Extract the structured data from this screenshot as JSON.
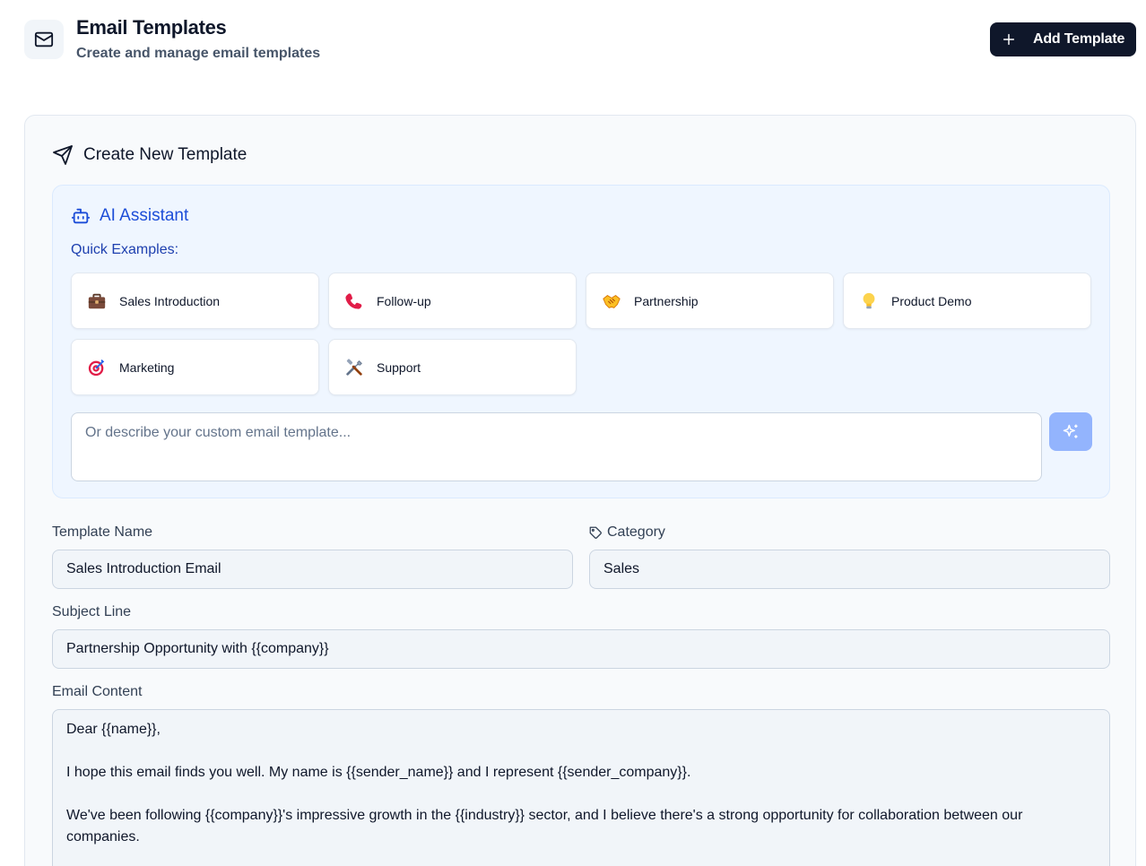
{
  "header": {
    "title": "Email Templates",
    "subtitle": "Create and manage email templates",
    "add_button": "Add Template"
  },
  "form": {
    "title": "Create New Template",
    "ai": {
      "title": "AI Assistant",
      "quick_label": "Quick Examples:",
      "examples": [
        {
          "label": "Sales Introduction",
          "icon": "briefcase-icon"
        },
        {
          "label": "Follow-up",
          "icon": "phone-icon"
        },
        {
          "label": "Partnership",
          "icon": "handshake-icon"
        },
        {
          "label": "Product Demo",
          "icon": "lightbulb-icon"
        },
        {
          "label": "Marketing",
          "icon": "target-icon"
        },
        {
          "label": "Support",
          "icon": "tools-icon"
        }
      ],
      "custom_placeholder": "Or describe your custom email template..."
    },
    "name_label": "Template Name",
    "name_value": "Sales Introduction Email",
    "category_label": "Category",
    "category_value": "Sales",
    "subject_label": "Subject Line",
    "subject_value": "Partnership Opportunity with {{company}}",
    "content_label": "Email Content",
    "content_paragraphs": [
      "Dear {{name}},",
      "I hope this email finds you well. My name is {{sender_name}} and I represent {{sender_company}}.",
      "We've been following {{company}}'s impressive growth in the {{industry}} sector, and I believe there's a strong opportunity for collaboration between our companies."
    ]
  },
  "colors": {
    "primary": "#0f172a",
    "ai_accent": "#1d4ed8",
    "ai_bg": "#eff6ff",
    "generate_button": "#93b4fd"
  }
}
